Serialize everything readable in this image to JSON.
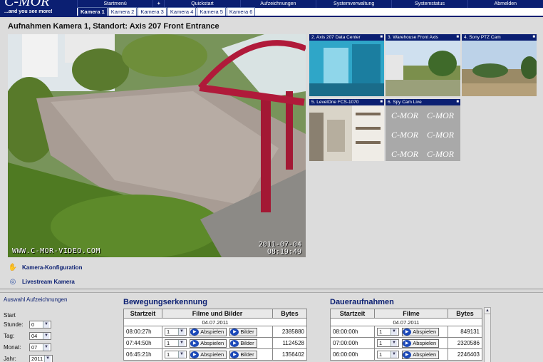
{
  "brand": {
    "name": "C-MOR",
    "slogan": "...and you see more!"
  },
  "topnav": [
    {
      "label": "Startmenü"
    },
    {
      "label": "+"
    },
    {
      "label": "Quickstart"
    },
    {
      "label": "Aufzeichnungen"
    },
    {
      "label": "Systemverwaltung"
    },
    {
      "label": "Systemstatus"
    },
    {
      "label": "Abmelden"
    }
  ],
  "tabs": [
    {
      "label": "Kamera 1",
      "active": true
    },
    {
      "label": "Kamera 2"
    },
    {
      "label": "Kamera 3"
    },
    {
      "label": "Kamera 4"
    },
    {
      "label": "Kamera 5"
    },
    {
      "label": "Kamera 6"
    }
  ],
  "main": {
    "title": "Aufnahmen Kamera 1, Standort: Axis 207 Front Entrance",
    "video": {
      "watermark": "WWW.C-MOR-VIDEO.COM",
      "date": "2011-07-04",
      "time": "08:19:49"
    }
  },
  "thumbnails": [
    {
      "label": "2. Axis 207 Data Center"
    },
    {
      "label": "3. Warehouse Front Axis"
    },
    {
      "label": "4. Sony PTZ Cam"
    },
    {
      "label": "5. LevelOne FCS-1070"
    },
    {
      "label": "6. Spy Cam Live",
      "logo": "C-MOR"
    }
  ],
  "links": [
    {
      "label": "Kamera-Konfiguration",
      "icon": "hand-icon"
    },
    {
      "label": "Livestream Kamera",
      "icon": "eye-icon"
    }
  ],
  "filter": {
    "title": "Auswahl Aufzeichnungen",
    "start": "Start",
    "fields": [
      {
        "label": "Stunde:",
        "value": "0"
      },
      {
        "label": "Tag:",
        "value": "04"
      },
      {
        "label": "Monat:",
        "value": "07"
      },
      {
        "label": "Jahr:",
        "value": "2011"
      }
    ]
  },
  "motion": {
    "title": "Bewegungserkennung",
    "headers": [
      "Startzeit",
      "Filme und Bilder",
      "Bytes"
    ],
    "date": "04.07.2011",
    "play": "Abspielen",
    "images": "Bilder",
    "rows": [
      {
        "time": "08:00:27h",
        "sel": "1",
        "bytes": "2385880"
      },
      {
        "time": "07:44:50h",
        "sel": "1",
        "bytes": "1124528"
      },
      {
        "time": "06:45:21h",
        "sel": "1",
        "bytes": "1356402"
      }
    ]
  },
  "continuous": {
    "title": "Daueraufnahmen",
    "headers": [
      "Startzeit",
      "Filme",
      "Bytes"
    ],
    "date": "04.07.2011",
    "play": "Abspielen",
    "rows": [
      {
        "time": "08:00:00h",
        "sel": "1",
        "bytes": "849131"
      },
      {
        "time": "07:00:00h",
        "sel": "1",
        "bytes": "2320586"
      },
      {
        "time": "06:00:00h",
        "sel": "1",
        "bytes": "2246403"
      }
    ]
  },
  "colors": {
    "navy": "#0b1f72",
    "panel": "#dcdcdc",
    "button_icon": "#1c49b8"
  }
}
